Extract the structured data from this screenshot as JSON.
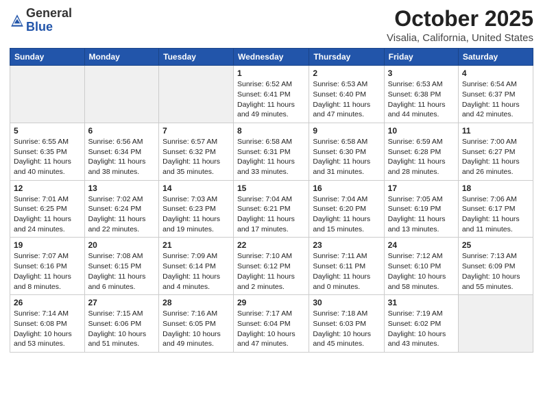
{
  "header": {
    "logo_general": "General",
    "logo_blue": "Blue",
    "month_title": "October 2025",
    "location": "Visalia, California, United States"
  },
  "days_of_week": [
    "Sunday",
    "Monday",
    "Tuesday",
    "Wednesday",
    "Thursday",
    "Friday",
    "Saturday"
  ],
  "weeks": [
    [
      {
        "day": "",
        "info": ""
      },
      {
        "day": "",
        "info": ""
      },
      {
        "day": "",
        "info": ""
      },
      {
        "day": "1",
        "info": "Sunrise: 6:52 AM\nSunset: 6:41 PM\nDaylight: 11 hours\nand 49 minutes."
      },
      {
        "day": "2",
        "info": "Sunrise: 6:53 AM\nSunset: 6:40 PM\nDaylight: 11 hours\nand 47 minutes."
      },
      {
        "day": "3",
        "info": "Sunrise: 6:53 AM\nSunset: 6:38 PM\nDaylight: 11 hours\nand 44 minutes."
      },
      {
        "day": "4",
        "info": "Sunrise: 6:54 AM\nSunset: 6:37 PM\nDaylight: 11 hours\nand 42 minutes."
      }
    ],
    [
      {
        "day": "5",
        "info": "Sunrise: 6:55 AM\nSunset: 6:35 PM\nDaylight: 11 hours\nand 40 minutes."
      },
      {
        "day": "6",
        "info": "Sunrise: 6:56 AM\nSunset: 6:34 PM\nDaylight: 11 hours\nand 38 minutes."
      },
      {
        "day": "7",
        "info": "Sunrise: 6:57 AM\nSunset: 6:32 PM\nDaylight: 11 hours\nand 35 minutes."
      },
      {
        "day": "8",
        "info": "Sunrise: 6:58 AM\nSunset: 6:31 PM\nDaylight: 11 hours\nand 33 minutes."
      },
      {
        "day": "9",
        "info": "Sunrise: 6:58 AM\nSunset: 6:30 PM\nDaylight: 11 hours\nand 31 minutes."
      },
      {
        "day": "10",
        "info": "Sunrise: 6:59 AM\nSunset: 6:28 PM\nDaylight: 11 hours\nand 28 minutes."
      },
      {
        "day": "11",
        "info": "Sunrise: 7:00 AM\nSunset: 6:27 PM\nDaylight: 11 hours\nand 26 minutes."
      }
    ],
    [
      {
        "day": "12",
        "info": "Sunrise: 7:01 AM\nSunset: 6:25 PM\nDaylight: 11 hours\nand 24 minutes."
      },
      {
        "day": "13",
        "info": "Sunrise: 7:02 AM\nSunset: 6:24 PM\nDaylight: 11 hours\nand 22 minutes."
      },
      {
        "day": "14",
        "info": "Sunrise: 7:03 AM\nSunset: 6:23 PM\nDaylight: 11 hours\nand 19 minutes."
      },
      {
        "day": "15",
        "info": "Sunrise: 7:04 AM\nSunset: 6:21 PM\nDaylight: 11 hours\nand 17 minutes."
      },
      {
        "day": "16",
        "info": "Sunrise: 7:04 AM\nSunset: 6:20 PM\nDaylight: 11 hours\nand 15 minutes."
      },
      {
        "day": "17",
        "info": "Sunrise: 7:05 AM\nSunset: 6:19 PM\nDaylight: 11 hours\nand 13 minutes."
      },
      {
        "day": "18",
        "info": "Sunrise: 7:06 AM\nSunset: 6:17 PM\nDaylight: 11 hours\nand 11 minutes."
      }
    ],
    [
      {
        "day": "19",
        "info": "Sunrise: 7:07 AM\nSunset: 6:16 PM\nDaylight: 11 hours\nand 8 minutes."
      },
      {
        "day": "20",
        "info": "Sunrise: 7:08 AM\nSunset: 6:15 PM\nDaylight: 11 hours\nand 6 minutes."
      },
      {
        "day": "21",
        "info": "Sunrise: 7:09 AM\nSunset: 6:14 PM\nDaylight: 11 hours\nand 4 minutes."
      },
      {
        "day": "22",
        "info": "Sunrise: 7:10 AM\nSunset: 6:12 PM\nDaylight: 11 hours\nand 2 minutes."
      },
      {
        "day": "23",
        "info": "Sunrise: 7:11 AM\nSunset: 6:11 PM\nDaylight: 11 hours\nand 0 minutes."
      },
      {
        "day": "24",
        "info": "Sunrise: 7:12 AM\nSunset: 6:10 PM\nDaylight: 10 hours\nand 58 minutes."
      },
      {
        "day": "25",
        "info": "Sunrise: 7:13 AM\nSunset: 6:09 PM\nDaylight: 10 hours\nand 55 minutes."
      }
    ],
    [
      {
        "day": "26",
        "info": "Sunrise: 7:14 AM\nSunset: 6:08 PM\nDaylight: 10 hours\nand 53 minutes."
      },
      {
        "day": "27",
        "info": "Sunrise: 7:15 AM\nSunset: 6:06 PM\nDaylight: 10 hours\nand 51 minutes."
      },
      {
        "day": "28",
        "info": "Sunrise: 7:16 AM\nSunset: 6:05 PM\nDaylight: 10 hours\nand 49 minutes."
      },
      {
        "day": "29",
        "info": "Sunrise: 7:17 AM\nSunset: 6:04 PM\nDaylight: 10 hours\nand 47 minutes."
      },
      {
        "day": "30",
        "info": "Sunrise: 7:18 AM\nSunset: 6:03 PM\nDaylight: 10 hours\nand 45 minutes."
      },
      {
        "day": "31",
        "info": "Sunrise: 7:19 AM\nSunset: 6:02 PM\nDaylight: 10 hours\nand 43 minutes."
      },
      {
        "day": "",
        "info": ""
      }
    ]
  ]
}
